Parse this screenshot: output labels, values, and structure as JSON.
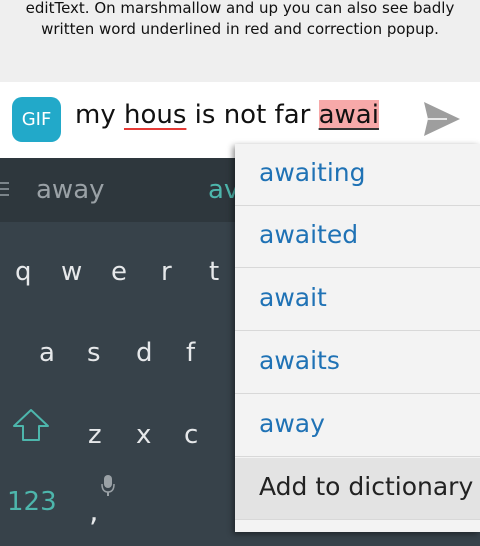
{
  "description": {
    "line1": "editText. On marshmallow and up you can also see badly",
    "line2": "written word underlined in red and correction popup."
  },
  "input": {
    "gif_label": "GIF",
    "words": [
      "my",
      "hous",
      "is not far",
      "awai"
    ]
  },
  "keyboard": {
    "suggestions": [
      "away",
      "av"
    ],
    "row1": [
      "q",
      "w",
      "e",
      "r",
      "t"
    ],
    "row2": [
      "a",
      "s",
      "d",
      "f"
    ],
    "row3": [
      "z",
      "x",
      "c"
    ],
    "symbols_label": "123",
    "comma": ","
  },
  "popup": {
    "items": [
      "awaiting",
      "awaited",
      "await",
      "awaits",
      "away"
    ],
    "add_to_dictionary": "Add to dictionary"
  },
  "colors": {
    "accent": "#4db6ac",
    "link_blue": "#1f72b5",
    "gif_bg": "#22a9c9",
    "misspell_red": "#e53935",
    "keyboard_bg": "#37424a"
  }
}
